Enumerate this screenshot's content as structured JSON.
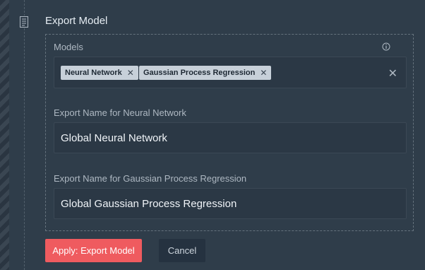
{
  "section": {
    "title": "Export Model",
    "icon": "document-list-icon"
  },
  "models": {
    "label": "Models",
    "tags": [
      {
        "label": "Neural Network"
      },
      {
        "label": "Gaussian Process Regression"
      }
    ]
  },
  "fields": [
    {
      "label": "Export Name for Neural Network",
      "value": "Global Neural Network"
    },
    {
      "label": "Export Name for Gaussian Process Regression",
      "value": "Global Gaussian Process Regression"
    }
  ],
  "buttons": {
    "apply": "Apply: Export Model",
    "cancel": "Cancel"
  },
  "colors": {
    "accent": "#ef5b5f",
    "background": "#2f3d4a",
    "field": "#2b3845"
  }
}
